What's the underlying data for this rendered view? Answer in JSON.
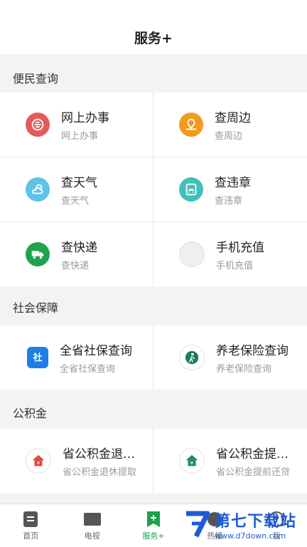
{
  "header": {
    "title": "服务+"
  },
  "sections": [
    {
      "title": "便民查询"
    },
    {
      "title": "社会保障"
    },
    {
      "title": "公积金"
    }
  ],
  "services": {
    "bianmin": [
      {
        "name": "网上办事",
        "sub": "网上办事",
        "icon": "e-gov-icon",
        "color": "#e35a5a"
      },
      {
        "name": "查周边",
        "sub": "查周边",
        "icon": "map-location-icon",
        "color": "#f29a1a"
      },
      {
        "name": "查天气",
        "sub": "查天气",
        "icon": "weather-icon",
        "color": "#5ec3e6"
      },
      {
        "name": "查违章",
        "sub": "查违章",
        "icon": "car-violation-icon",
        "color": "#3fc0b9"
      },
      {
        "name": "查快递",
        "sub": "查快递",
        "icon": "delivery-truck-icon",
        "color": "#1fa34d"
      },
      {
        "name": "手机充值",
        "sub": "手机充值",
        "icon": "phone-recharge-icon",
        "color": "#efefef"
      }
    ],
    "shebao": [
      {
        "name": "全省社保查询",
        "sub": "全省社保查询",
        "icon": "social-security-icon",
        "color": "#1e7ee8"
      },
      {
        "name": "养老保险查询",
        "sub": "养老保险查询",
        "icon": "elderly-insurance-icon",
        "color": "#1f7a5a"
      }
    ],
    "gjj": [
      {
        "name": "省公积金退休提取",
        "sub": "省公积金退休提取",
        "icon": "fund-house-icon",
        "color": "#e34a3a"
      },
      {
        "name": "省公积金提前还贷",
        "sub": "省公积金提前还贷",
        "icon": "fund-house-icon",
        "color": "#1f8a6a"
      }
    ]
  },
  "tabs": [
    {
      "label": "首页",
      "icon": "home-icon"
    },
    {
      "label": "电视",
      "icon": "tv-icon"
    },
    {
      "label": "服务+",
      "icon": "service-icon",
      "active": true
    },
    {
      "label": "热播",
      "icon": "hot-icon"
    },
    {
      "label": "我",
      "icon": "profile-icon"
    }
  ],
  "watermark": {
    "title": "第七下载站",
    "url": "www.d7down.com"
  }
}
